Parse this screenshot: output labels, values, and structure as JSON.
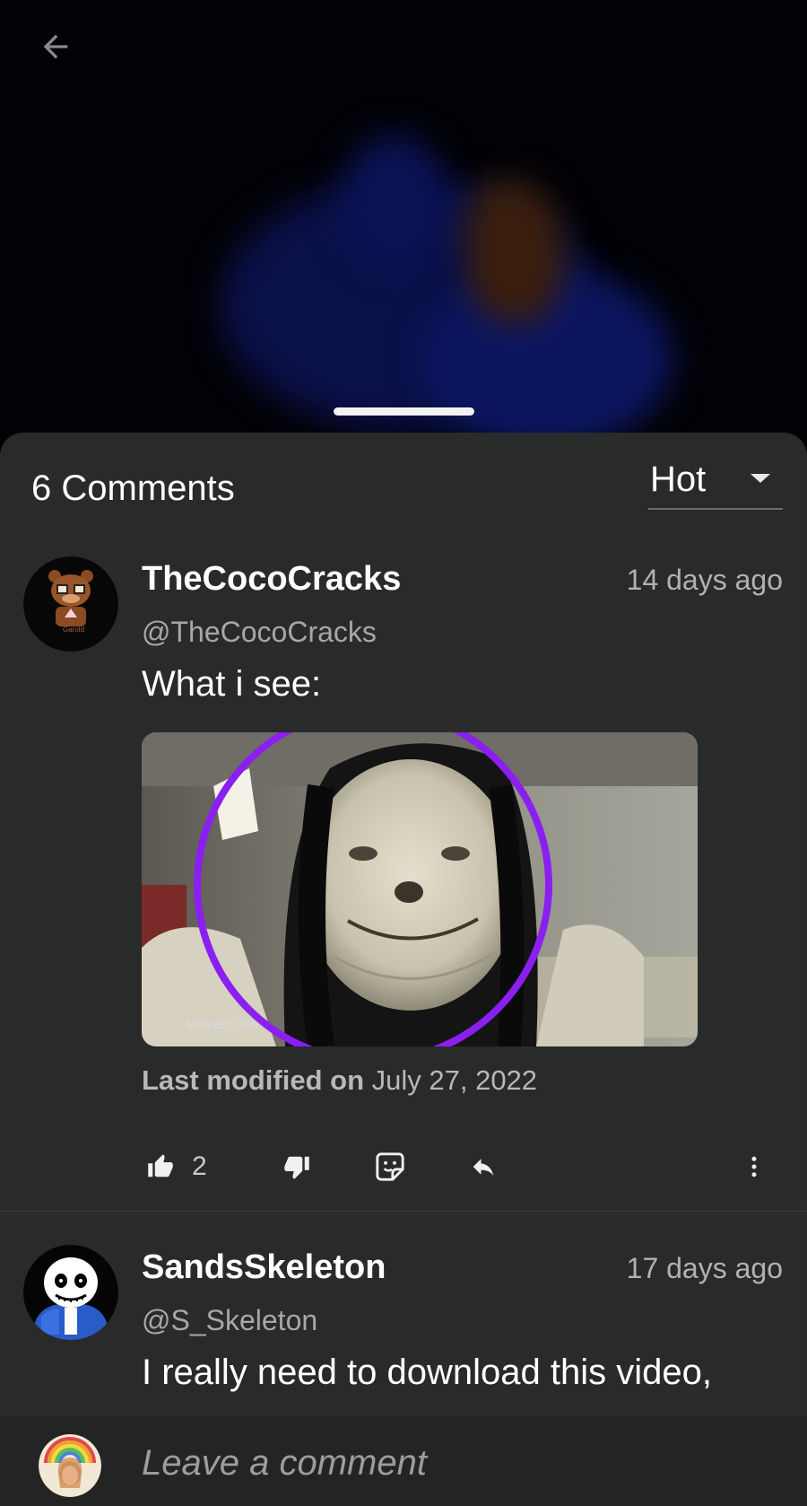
{
  "comments_header": {
    "count_label": "6 Comments",
    "sort_value": "Hot"
  },
  "comments": [
    {
      "username": "TheCocoCracks",
      "handle": "@TheCocoCracks",
      "time": "14 days ago",
      "text": "What i see:",
      "attachment_watermark": "MOVIECLIPS",
      "avatar_text": "Garold",
      "modified_prefix": "Last modified on",
      "modified_date": "July 27, 2022",
      "likes": "2"
    },
    {
      "username": "SandsSkeleton",
      "handle": "@S_Skeleton",
      "time": "17 days ago",
      "text": "I really need to download this video,"
    }
  ],
  "composer": {
    "placeholder": "Leave a comment"
  },
  "colors": {
    "sheet_bg": "#292b2a",
    "accent_circle": "#8b1ff2"
  }
}
